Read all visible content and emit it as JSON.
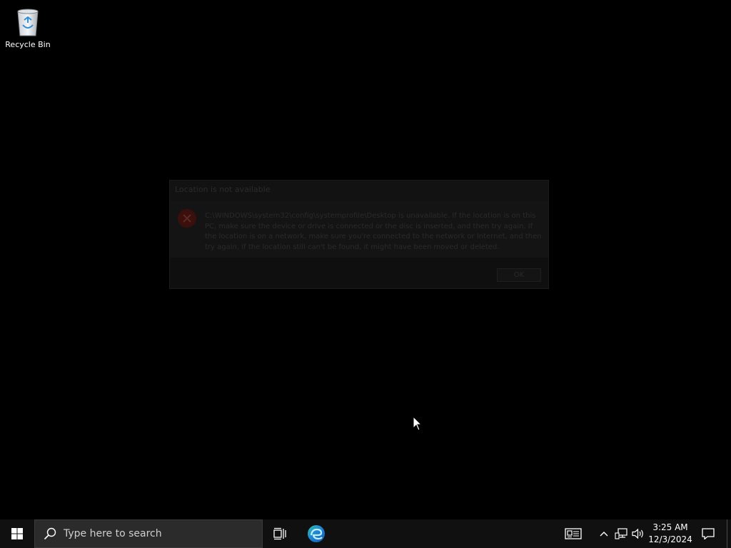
{
  "desktop": {
    "icons": [
      {
        "label": "Recycle Bin",
        "icon": "recycle-bin-icon"
      }
    ]
  },
  "dialog": {
    "title": "Location is not available",
    "icon": "error-icon",
    "message": "C:\\WINDOWS\\system32\\config\\systemprofile\\Desktop is unavailable. If the location is on this PC, make sure the device or drive is connected or the disc is inserted, and then try again. If the location is on a network, make sure you're connected to the network or Internet, and then try again. If the location still can't be found, it might have been moved or deleted.",
    "ok_label": "OK"
  },
  "taskbar": {
    "start_icon": "windows-logo-icon",
    "search_placeholder": "Type here to search",
    "pinned": [
      {
        "name": "Task View",
        "icon": "task-view-icon"
      },
      {
        "name": "Microsoft Edge",
        "icon": "edge-icon"
      }
    ],
    "tray": {
      "news_icon": "news-icon",
      "chevron_icon": "chevron-up-icon",
      "network_icon": "network-icon",
      "volume_icon": "volume-icon",
      "notification_icon": "notification-icon"
    },
    "clock": {
      "time": "3:25 AM",
      "date": "12/3/2024"
    }
  },
  "colors": {
    "desktop_bg": "#000000",
    "taskbar_bg": "#101010",
    "search_bg": "#2b2b2b",
    "edge_blue": "#1e88d6",
    "edge_green": "#3fbf6a"
  }
}
